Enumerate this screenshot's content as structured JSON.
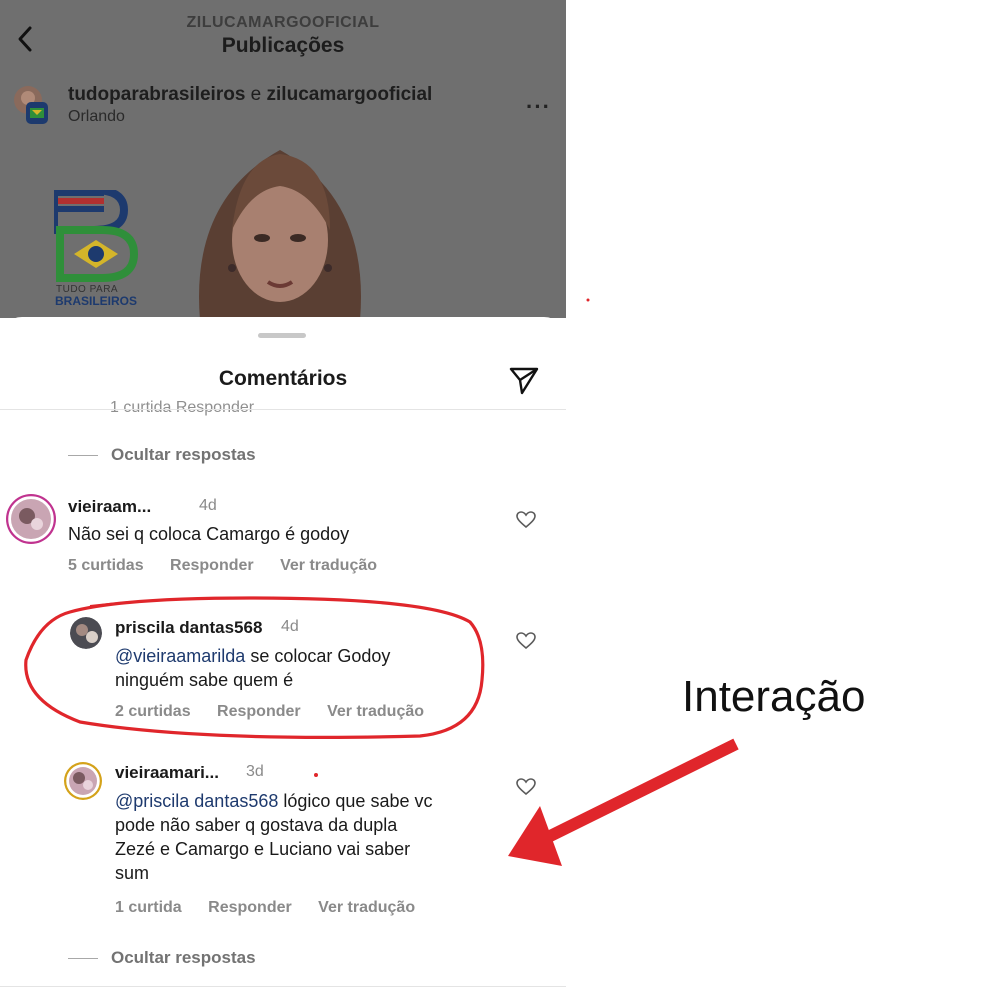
{
  "header": {
    "account_handle": "ZILUCAMARGOOFICIAL",
    "title": "Publicações"
  },
  "post": {
    "author_primary": "tudoparabrasileiros",
    "author_joiner": "e",
    "author_secondary": "zilucamargooficial",
    "location": "Orlando",
    "more_label": "···",
    "logo_text_small": "TUDO PARA",
    "logo_text_big": "BRASILEIROS"
  },
  "comments_sheet": {
    "title": "Comentários",
    "partial_line": "1 curtida    Responder",
    "hide_replies_top": "Ocultar respostas",
    "hide_replies_bottom": "Ocultar respostas",
    "comments": [
      {
        "username": "vieiraam...",
        "time": "4d",
        "text": "Não sei q coloca Camargo é godoy",
        "likes": "5 curtidas",
        "reply": "Responder",
        "translate": "Ver tradução"
      },
      {
        "username": "priscila dantas568",
        "username_exact": "priscila dantas568",
        "time": "4d",
        "mention": "@vieiraamarilda",
        "text_line1": " se colocar Godoy",
        "text_line2": "ninguém sabe quem é",
        "likes": "2 curtidas",
        "reply": "Responder",
        "translate": "Ver tradução"
      },
      {
        "username": "vieiraamari...",
        "time": "3d",
        "mention": "@priscila dantas568",
        "text_line1": " lógico que sabe vc",
        "text_line2": "pode não saber  q  gostava da dupla",
        "text_line3": "Zezé e Camargo e Luciano vai saber",
        "text_line4": "sum",
        "likes": "1 curtida",
        "reply": "Responder",
        "translate": "Ver tradução"
      }
    ]
  },
  "annotation": {
    "label": "Interação",
    "circle_color": "#e0262b",
    "arrow_color": "#e0262b"
  }
}
